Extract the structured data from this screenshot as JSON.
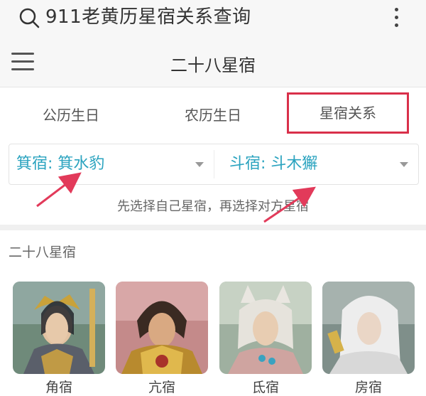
{
  "search": {
    "text": "911老黄历星宿关系查询"
  },
  "header": {
    "title": "二十八星宿"
  },
  "tabs": [
    {
      "label": "公历生日"
    },
    {
      "label": "农历生日"
    },
    {
      "label": "星宿关系"
    }
  ],
  "selects": {
    "left_value": "箕宿: 箕水豹",
    "right_value": "斗宿: 斗木獬"
  },
  "hint": "先选择自己星宿，再选择对方星宿",
  "section": {
    "title": "二十八星宿"
  },
  "cards": [
    {
      "label": "角宿"
    },
    {
      "label": "亢宿"
    },
    {
      "label": "氐宿"
    },
    {
      "label": "房宿"
    }
  ],
  "colors": {
    "accent": "#2aa3bf",
    "highlight": "#d9304a",
    "arrow": "#e23a5a"
  }
}
